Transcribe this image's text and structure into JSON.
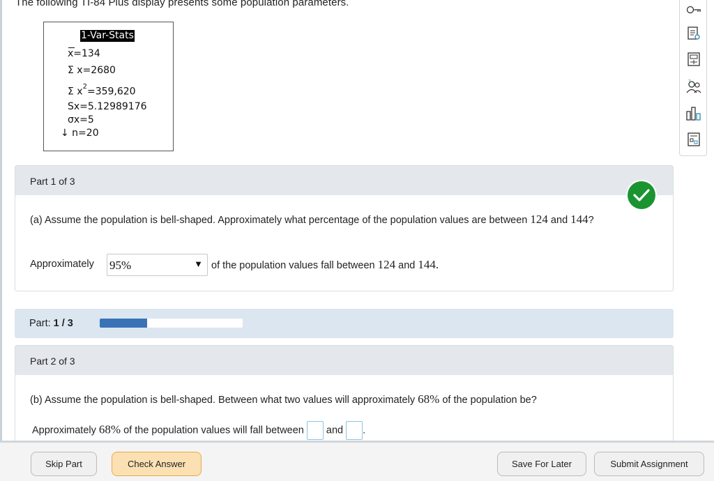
{
  "intro": "The following TI-84 Plus display presents some population parameters.",
  "calculator": {
    "header": "1-Var-Stats",
    "lines": [
      "x=134",
      "Σ x=2680",
      "Σ x",
      "=359,620",
      "Sx=5.12989176",
      "σx=5",
      "↓ n=20"
    ],
    "sup": "2"
  },
  "sidebar_icons": [
    "key-icon",
    "reading-icon",
    "calculator-icon",
    "help-people-icon",
    "chart-icon",
    "worksheet-icon"
  ],
  "part1": {
    "header": "Part 1 of 3",
    "question_pre": "(a) Assume the population is bell-shaped. Approximately what percentage of the population values are between ",
    "v1": "124",
    "and": " and ",
    "v2": "144",
    "q_end": "?",
    "answer_pre": "Approximately",
    "selected": "95%",
    "answer_post": "of the population values fall between",
    "a1": "124",
    "a_and": "and",
    "a2": "144."
  },
  "progress": {
    "label": "Part:",
    "value": "1 / 3",
    "fraction": 0.33
  },
  "part2": {
    "header": "Part 2 of 3",
    "question_pre": "(b) Assume the population is bell-shaped. Between what two values will approximately ",
    "pct": "68%",
    "question_post": " of the population be?",
    "answer_pre": "Approximately",
    "answer_pct": "68%",
    "answer_mid": "of the population values will fall between",
    "answer_and": "and",
    "answer_end": "."
  },
  "buttons": {
    "skip": "Skip Part",
    "check": "Check Answer",
    "save": "Save For Later",
    "submit": "Submit Assignment"
  },
  "colors": {
    "accent": "#3a73b5",
    "success": "#1a9431",
    "check_button": "#fbe0b3"
  }
}
